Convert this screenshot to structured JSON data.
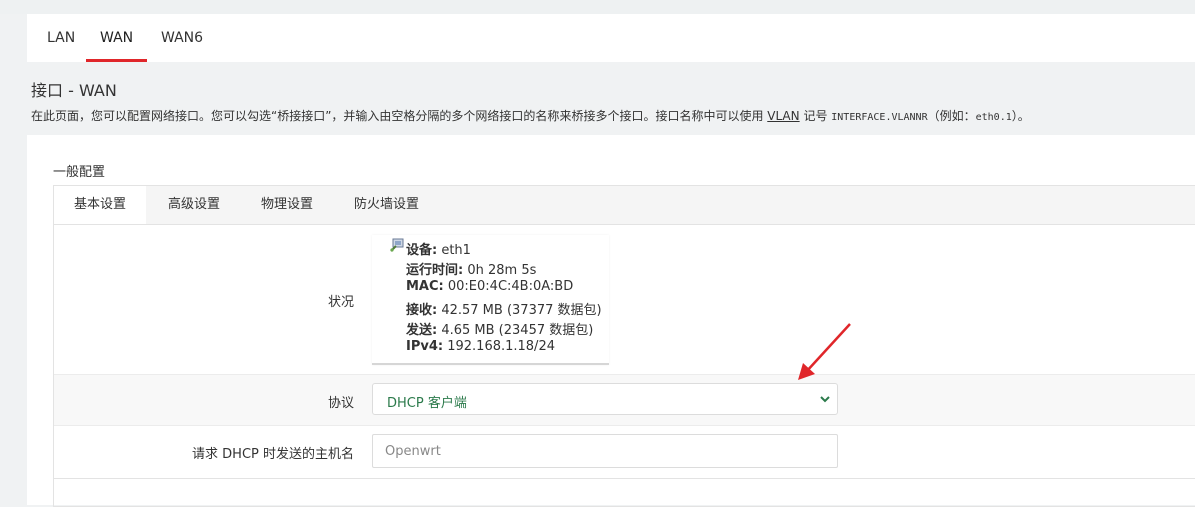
{
  "tabs": [
    {
      "label": "LAN",
      "active": false
    },
    {
      "label": "WAN",
      "active": true
    },
    {
      "label": "WAN6",
      "active": false
    }
  ],
  "page": {
    "title": "接口 - WAN",
    "desc_part1": "在此页面，您可以配置网络接口。您可以勾选“桥接接口”，并输入由空格分隔的多个网络接口的名称来桥接多个接口。接口名称中可以使用 ",
    "desc_vlan": "VLAN",
    "desc_part2": " 记号 ",
    "desc_code1": "INTERFACE.VLANNR",
    "desc_part3": "（例如：",
    "desc_code2": "eth0.1",
    "desc_part4": "）。"
  },
  "section": {
    "title": "一般配置",
    "subtabs": [
      {
        "label": "基本设置",
        "active": true
      },
      {
        "label": "高级设置",
        "active": false
      },
      {
        "label": "物理设置",
        "active": false
      },
      {
        "label": "防火墙设置",
        "active": false
      }
    ]
  },
  "status": {
    "label": "状况",
    "icon": "network-port-icon",
    "lines": [
      {
        "key": "设备:",
        "value": " eth1"
      },
      {
        "key": "运行时间:",
        "value": " 0h 28m 5s"
      },
      {
        "key": "MAC:",
        "value": " 00:E0:4C:4B:0A:BD"
      },
      {
        "key": "接收:",
        "value": " 42.57 MB (37377 数据包)"
      },
      {
        "key": "发送:",
        "value": " 4.65 MB (23457 数据包)"
      },
      {
        "key": "IPv4:",
        "value": " 192.168.1.18/24"
      }
    ]
  },
  "protocol": {
    "label": "协议",
    "selected": "DHCP 客户端"
  },
  "hostname": {
    "label": "请求 DHCP 时发送的主机名",
    "placeholder": "Openwrt"
  },
  "colors": {
    "accent": "#e0262a",
    "select_text": "#2b7a4b"
  }
}
